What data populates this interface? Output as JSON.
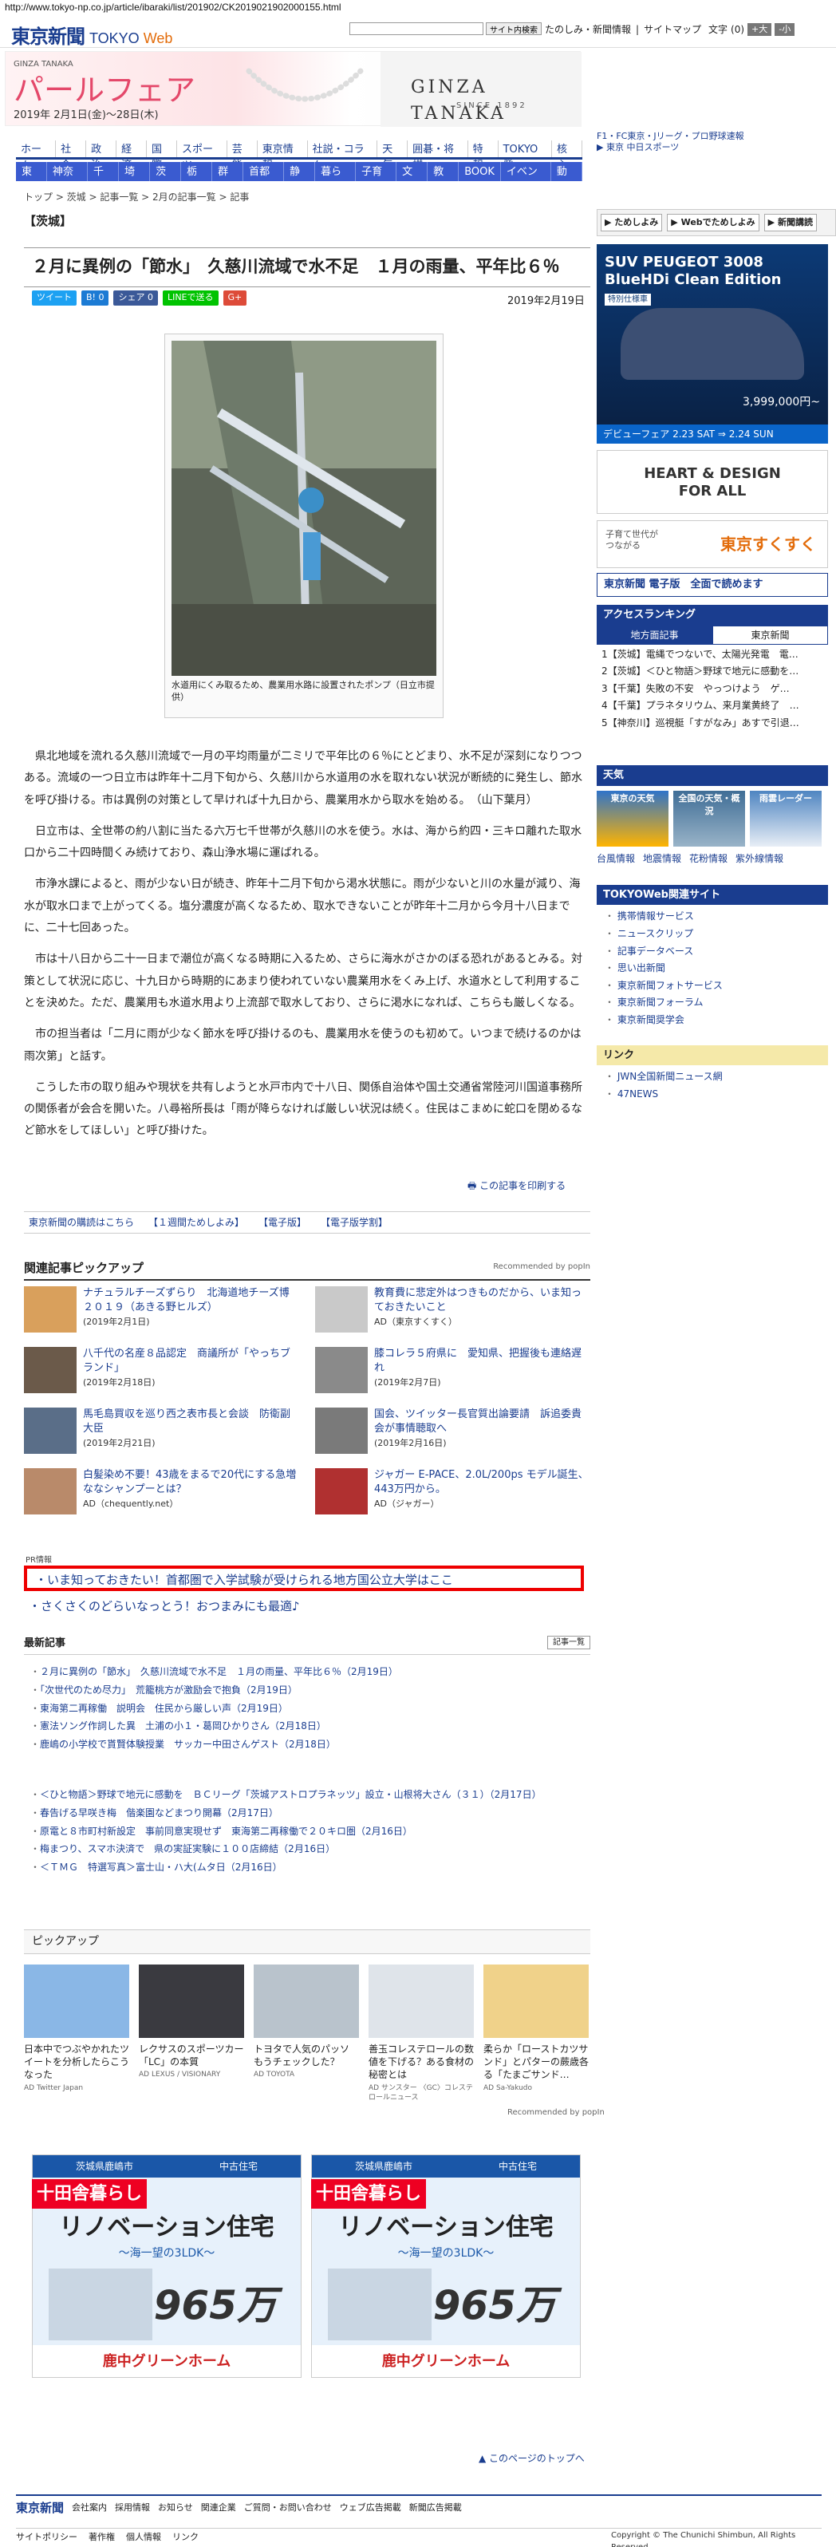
{
  "url": "http://www.tokyo-np.co.jp/article/ibaraki/list/201902/CK2019021902000155.html",
  "header": {
    "logo": "東京新聞",
    "logo_sub": "TOKYO",
    "logo_web": "Web",
    "search_button": "サイト内検索",
    "links": [
      "たのしみ・新聞情報",
      "サイトマップ"
    ],
    "font_label": "文字",
    "font_value": "(0)",
    "font_plus": "+大",
    "font_minus": "-小"
  },
  "topad": {
    "brand": "GINZA TANAKA",
    "title": "パールフェア",
    "dates": "2019年 2月1日(金)〜28日(木)",
    "logo": "GINZA TANAKA",
    "since": "SINCE 1892"
  },
  "rtop": [
    "F1・FC東京・Jリーグ・プロ野球速報",
    "▶ 東京 中日スポーツ"
  ],
  "nav1": [
    "ホーム",
    "社会",
    "政治",
    "経済",
    "国際",
    "スポーツ",
    "芸能",
    "東京情報",
    "社説・コラム",
    "天気",
    "囲碁・将棋",
    "特報",
    "TOKYO発",
    "核心"
  ],
  "nav2": [
    "東京",
    "神奈川",
    "千葉",
    "埼玉",
    "茨城",
    "栃木",
    "群馬",
    "首都圏",
    "静岡",
    "暮らし",
    "子育て",
    "文化",
    "教育",
    "BOOK",
    "イベント",
    "動画"
  ],
  "breadcrumb": "トップ > 茨城 > 記事一覧 > 2月の記事一覧 > 記事",
  "section": "【茨城】",
  "article": {
    "title": "２月に異例の「節水」　久慈川流域で水不足　１月の雨量、平年比６％",
    "date": "2019年2月19日",
    "share": [
      "ツイート",
      "B! 0",
      "シェア 0",
      "LINEで送る",
      "G+"
    ],
    "caption": "水道用にくみ取るため、農業用水路に設置されたポンプ（日立市提供）",
    "paragraphs": [
      "県北地域を流れる久慈川流域で一月の平均雨量が二ミリで平年比の６％にとどまり、水不足が深刻になりつつある。流域の一つ日立市は昨年十二月下旬から、久慈川から水道用の水を取れない状況が断続的に発生し、節水を呼び掛ける。市は異例の対策として早ければ十九日から、農業用水から取水を始める。　（山下葉月）",
      "日立市は、全世帯の約八割に当たる六万七千世帯が久慈川の水を使う。水は、海から約四・三キロ離れた取水口から二十四時間くみ続けており、森山浄水場に運ばれる。",
      "市浄水課によると、雨が少ない日が続き、昨年十二月下旬から渇水状態に。雨が少ないと川の水量が減り、海水が取水口まで上がってくる。塩分濃度が高くなるため、取水できないことが昨年十二月から今月十八日までに、二十七回あった。",
      "市は十八日から二十一日まで潮位が高くなる時期に入るため、さらに海水がさかのぼる恐れがあるとみる。対策として状況に応じ、十九日から時期的にあまり使われていない農業用水をくみ上げ、水道水として利用することを決めた。ただ、農業用も水道水用より上流部で取水しており、さらに渇水になれば、こちらも厳しくなる。",
      "市の担当者は「二月に雨が少なく節水を呼び掛けるのも、農業用水を使うのも初めて。いつまで続けるのかは雨次第」と話す。",
      "こうした市の取り組みや現状を共有しようと水戸市内で十八日、関係自治体や国土交通省常陸河川国道事務所の関係者が会合を開いた。八尋裕所長は「雨が降らなければ厳しい状況は続く。住民はこまめに蛇口を閉めるなど節水をしてほしい」と呼び掛けた。"
    ],
    "print": "この記事を印刷する"
  },
  "subscribe": [
    "東京新聞の購読はこちら",
    "【１週間ためしよみ】",
    "【電子版】",
    "【電子版学割】"
  ],
  "pickup": {
    "title": "関連記事ピックアップ",
    "recommended": "Recommended by popIn",
    "items": [
      {
        "text": "ナチュラルチーズずらり　北海道地チーズ博２０１９（あきる野ヒルズ）",
        "date": "(2019年2月1日)",
        "color": "#d9a05c"
      },
      {
        "text": "教育費に悲定外はつきものだから、いま知っておきたいこと",
        "date": "AD（東京すくすく）",
        "color": "#c9c9c9"
      },
      {
        "text": "八千代の名産８品認定　商議所が「やっちブランド」",
        "date": "(2019年2月18日)",
        "color": "#6b5a4a"
      },
      {
        "text": "膝コレラ５府県に　愛知県、把握後も連絡遅れ",
        "date": "(2019年2月7日)",
        "color": "#8a8a8a"
      },
      {
        "text": "馬毛島買収を巡り西之表市長と会談　防衛副大臣",
        "date": "(2019年2月21日)",
        "color": "#5a6e88"
      },
      {
        "text": "国会、ツイッター長官質出論要請　訴追委貴会が事情聴取へ",
        "date": "(2019年2月16日)",
        "color": "#7a7a7a"
      },
      {
        "text": "白髪染め不要！43歳をまるで20代にする急増ななシャンプーとは？",
        "date": "AD（chequently.net）",
        "color": "#b98a6a"
      },
      {
        "text": "ジャガー E-PACE、2.0L/200ps モデル誕生、443万円から。",
        "date": "AD（ジャガー）",
        "color": "#b03030"
      }
    ]
  },
  "pr": {
    "label": "PR情報",
    "boxed": "いま知っておきたい！首都圏で入学試験が受けられる地方国公立大学はここ",
    "line": "さくさくのどらいなっとう！おつまみにも最適♪"
  },
  "latest": {
    "title": "最新記事",
    "more": "記事一覧",
    "group1": [
      "２月に異例の「節水」　久慈川流域で水不足　１月の雨量、平年比６％（2月19日）",
      "「次世代のため尽力」　荒籠桃方が激励会で抱負（2月19日）",
      "東海第二再稼働　説明会　住民から厳しい声（2月19日）",
      "憲法ソング作詞した異　土浦の小１・葛岡ひかりさん（2月18日）",
      "鹿嶋の小学校で貰賢体験授業　サッカー中田さんゲスト（2月18日）"
    ],
    "group2": [
      "＜ひと物語＞野球で地元に感動を　ＢＣリーグ「茨城アストロプラネッツ」設立・山根将大さん（３１）（2月17日）",
      "春告げる早咲き梅　偕楽園などまつり開幕（2月17日）",
      "原電と８市町村新設定　事前同意実現せず　東海第二再稼働で２０キロ圏（2月16日）",
      "梅まつり、スマホ決済で　県の実証実験に１００店締結（2月16日）",
      "＜ＴＭＧ　特選写真＞富士山・ハ大(ムタ日（2月16日）"
    ]
  },
  "pickup2": {
    "title": "ピックアップ",
    "recommended": "Recommended by popIn",
    "items": [
      {
        "text": "日本中でつぶやかれたツイートを分析したらこうなった",
        "ad": "AD Twitter Japan",
        "color": "#8ab7e6"
      },
      {
        "text": "レクサスのスポーツカー「LC」の本質",
        "ad": "AD LEXUS / VISIONARY",
        "color": "#3a3a40"
      },
      {
        "text": "トヨタで人気のパッソもうチェックした？",
        "ad": "AD TOYOTA",
        "color": "#b9c3cc"
      },
      {
        "text": "善玉コレステロールの数値を下げる？ある食材の秘密とは",
        "ad": "AD サンスター 〈GC〉コレステロールニュース",
        "color": "#dfe4ea"
      },
      {
        "text": "柔らか「ローストカツサンド」とパターの蕨歳各る「たまごサンド…",
        "ad": "AD Sa-Yakudo",
        "color": "#f0d28a"
      }
    ]
  },
  "bigads": [
    {
      "top1": "茨城県鹿嶋市",
      "top2": "中古住宅",
      "head": "リノベーション住宅",
      "sub": "〜海一望の3LDK〜",
      "price": "965万",
      "tag": "十田舎暮らし",
      "foot": "鹿中グリーンホーム"
    },
    {
      "top1": "茨城県鹿嶋市",
      "top2": "中古住宅",
      "head": "リノベーション住宅",
      "sub": "〜海一望の3LDK〜",
      "price": "965万",
      "tag": "十田舎暮らし",
      "foot": "鹿中グリーンホーム"
    }
  ],
  "pagetop": "▲ このページのトップへ",
  "footer": {
    "logo": "東京新聞",
    "links": [
      "会社案内",
      "採用情報",
      "お知らせ",
      "関連企業",
      "ご質問・お問い合わせ",
      "ウェブ広告掲載",
      "新聞広告掲載"
    ],
    "links2": [
      "サイトポリシー",
      "著作権",
      "個人情報",
      "リンク"
    ],
    "copyright": "Copyright © The Chunichi Shimbun, All Rights Reserved."
  },
  "sidebar": {
    "buttons": [
      "▶ ためしよみ",
      "▶ Webでためしよみ",
      "▶ 新聞講読"
    ],
    "carad": {
      "title": "SUV PEUGEOT 3008\nBlueHDi Clean Edition",
      "label": "特別仕様車",
      "price": "3,999,000円~",
      "bar": "デビューフェア 2.23 SAT ⇒ 2.24 SUN"
    },
    "hd": "HEART & DESIGN\nFOR ALL",
    "sugu": "東京すくすく",
    "sugu_sub": "子育て世代が\nつながる",
    "denshi": "東京新聞 電子版　全面で読めます",
    "ranking_title": "アクセスランキング",
    "ranking_tabs": [
      "地方面記事",
      "東京新聞"
    ],
    "ranking": [
      "1【茨城】電縄でつないで、太陽光発電　電…",
      "2【茨城】＜ひと物語＞野球で地元に感動を…",
      "3【千葉】失敗の不安　やっつけよう　ゲ…",
      "4【千葉】プラネタリウム、来月業黄終了　…",
      "5【神奈川】巡視艇「すがなみ」あすで引退…"
    ],
    "weather_title": "天気",
    "weather": [
      "東京の天気",
      "全国の天気・概況",
      "雨雲レーダー"
    ],
    "weather_links": [
      "台風情報",
      "地震情報",
      "花粉情報",
      "紫外線情報"
    ],
    "services_title": "TOKYOWeb関連サイト",
    "services": [
      "携帯情報サービス",
      "ニュースクリップ",
      "記事データベース",
      "思い出新聞",
      "東京新聞フォトサービス",
      "東京新聞フォーラム",
      "東京新聞奨学会"
    ],
    "link_title": "リンク",
    "links": [
      "JWN全国新聞ニュース網",
      "47NEWS"
    ]
  }
}
